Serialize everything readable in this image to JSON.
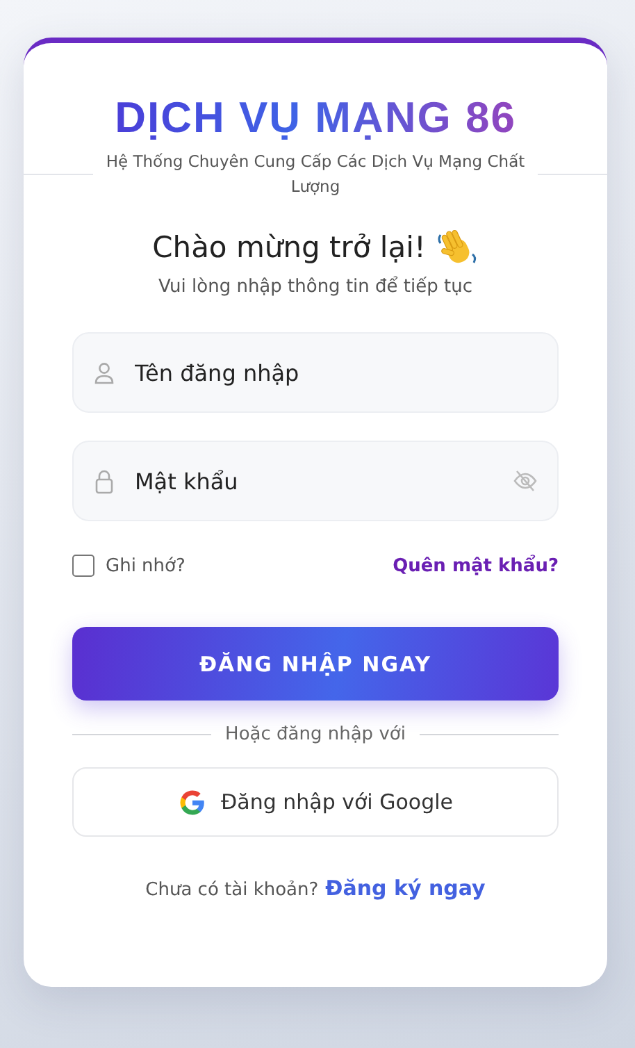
{
  "brand": {
    "title": "DỊCH VỤ MẠNG 86",
    "tagline": "Hệ Thống Chuyên Cung Cấp Các Dịch Vụ Mạng Chất Lượng"
  },
  "greeting": {
    "title": "Chào mừng trở lại!",
    "subtitle": "Vui lòng nhập thông tin để tiếp tục"
  },
  "fields": [
    {
      "kind": "username",
      "placeholder": "Tên đăng nhập"
    },
    {
      "kind": "password",
      "placeholder": "Mật khẩu"
    }
  ],
  "remember": {
    "label": "Ghi nhớ?",
    "checked": false
  },
  "forgot_link": "Quên mật khẩu?",
  "submit_button": "ĐĂNG NHẬP NGAY",
  "divider": "Hoặc đăng nhập với",
  "google_button": "Đăng nhập với Google",
  "footer": {
    "text": "Chưa có tài khoản?",
    "link": "Đăng ký ngay"
  }
}
